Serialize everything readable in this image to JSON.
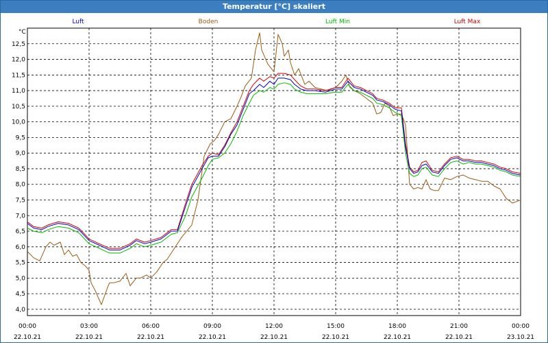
{
  "window": {
    "title": "Temperatur [°C] skaliert"
  },
  "chart_data": {
    "type": "line",
    "ylabel": "°C",
    "ylim": [
      3.8,
      13.0
    ],
    "y_ticks": [
      "4,0",
      "4,5",
      "5,0",
      "5,5",
      "6,0",
      "6,5",
      "7,0",
      "7,5",
      "8,0",
      "8,5",
      "9,0",
      "9,5",
      "10,0",
      "10,5",
      "11,0",
      "11,5",
      "12,0",
      "12,5"
    ],
    "y_tick_values": [
      4.0,
      4.5,
      5.0,
      5.5,
      6.0,
      6.5,
      7.0,
      7.5,
      8.0,
      8.5,
      9.0,
      9.5,
      10.0,
      10.5,
      11.0,
      11.5,
      12.0,
      12.5
    ],
    "x_range_hours": [
      0,
      24
    ],
    "x_ticks": [
      {
        "hour": 0,
        "time": "00:00",
        "date": "22.10.21"
      },
      {
        "hour": 3,
        "time": "03:00",
        "date": "22.10.21"
      },
      {
        "hour": 6,
        "time": "06:00",
        "date": "22.10.21"
      },
      {
        "hour": 9,
        "time": "09:00",
        "date": "22.10.21"
      },
      {
        "hour": 12,
        "time": "12:00",
        "date": "22.10.21"
      },
      {
        "hour": 15,
        "time": "15:00",
        "date": "22.10.21"
      },
      {
        "hour": 18,
        "time": "18:00",
        "date": "22.10.21"
      },
      {
        "hour": 21,
        "time": "21:00",
        "date": "22.10.21"
      },
      {
        "hour": 24,
        "time": "00:00",
        "date": "23.10.21"
      }
    ],
    "grid": true,
    "legend_position": "top",
    "series": [
      {
        "name": "Luft",
        "color": "#0000cc",
        "x": [
          0,
          0.3,
          0.7,
          1.0,
          1.5,
          2.0,
          2.5,
          3.0,
          3.5,
          4.0,
          4.5,
          5.0,
          5.3,
          5.7,
          6.0,
          6.5,
          7.0,
          7.3,
          7.7,
          8.0,
          8.5,
          8.8,
          9.0,
          9.3,
          9.6,
          9.9,
          10.2,
          10.5,
          10.8,
          11.0,
          11.3,
          11.5,
          11.8,
          12.0,
          12.2,
          12.5,
          12.8,
          13.0,
          13.3,
          13.6,
          14.0,
          14.5,
          15.0,
          15.3,
          15.6,
          15.9,
          16.2,
          16.5,
          16.8,
          17.0,
          17.3,
          17.6,
          17.9,
          18.2,
          18.4,
          18.6,
          18.8,
          19.0,
          19.2,
          19.4,
          19.7,
          20.0,
          20.3,
          20.6,
          20.9,
          21.2,
          21.5,
          21.8,
          22.1,
          22.4,
          22.7,
          23.0,
          23.3,
          23.6,
          24.0
        ],
        "y": [
          6.75,
          6.6,
          6.55,
          6.65,
          6.75,
          6.7,
          6.55,
          6.2,
          6.05,
          5.9,
          5.9,
          6.05,
          6.2,
          6.1,
          6.15,
          6.25,
          6.5,
          6.5,
          7.3,
          7.9,
          8.5,
          8.85,
          8.9,
          8.9,
          9.2,
          9.6,
          9.9,
          10.4,
          10.9,
          11.0,
          11.2,
          11.1,
          11.3,
          11.2,
          11.4,
          11.4,
          11.35,
          11.2,
          11.05,
          11.0,
          11.0,
          10.95,
          11.05,
          11.05,
          11.3,
          11.1,
          11.05,
          10.95,
          10.85,
          10.7,
          10.65,
          10.55,
          10.4,
          10.35,
          9.2,
          8.5,
          8.35,
          8.4,
          8.6,
          8.65,
          8.4,
          8.35,
          8.6,
          8.8,
          8.85,
          8.75,
          8.75,
          8.7,
          8.7,
          8.65,
          8.6,
          8.5,
          8.45,
          8.35,
          8.3
        ]
      },
      {
        "name": "Boden",
        "color": "#9c5a10",
        "x": [
          0,
          0.3,
          0.6,
          0.9,
          1.1,
          1.3,
          1.6,
          1.8,
          2.0,
          2.2,
          2.4,
          2.6,
          2.8,
          3.0,
          3.1,
          3.3,
          3.6,
          3.9,
          4.0,
          4.2,
          4.5,
          4.8,
          5.0,
          5.3,
          5.5,
          5.8,
          6.0,
          6.3,
          6.6,
          6.8,
          7.0,
          7.5,
          8.0,
          8.3,
          8.6,
          8.9,
          9.1,
          9.3,
          9.6,
          9.9,
          10.2,
          10.4,
          10.6,
          10.9,
          11.1,
          11.3,
          11.4,
          11.5,
          11.7,
          12.0,
          12.2,
          12.4,
          12.5,
          12.7,
          12.8,
          13.0,
          13.2,
          13.5,
          13.7,
          14.0,
          14.3,
          14.6,
          15.0,
          15.3,
          15.5,
          15.7,
          15.9,
          16.2,
          16.5,
          16.8,
          17.0,
          17.2,
          17.4,
          17.6,
          17.8,
          18.0,
          18.2,
          18.4,
          18.6,
          18.8,
          19.0,
          19.2,
          19.4,
          19.6,
          19.8,
          20.0,
          20.3,
          20.6,
          20.9,
          21.2,
          21.5,
          21.8,
          22.1,
          22.4,
          22.7,
          23.0,
          23.3,
          23.6,
          23.8,
          24.0
        ],
        "y": [
          5.85,
          5.65,
          5.55,
          6.0,
          6.15,
          6.05,
          6.15,
          5.75,
          5.9,
          5.7,
          5.75,
          5.5,
          5.4,
          5.25,
          4.85,
          4.6,
          4.15,
          4.7,
          4.85,
          4.85,
          4.9,
          5.15,
          4.75,
          5.0,
          5.0,
          5.1,
          5.0,
          5.2,
          5.5,
          5.6,
          5.8,
          6.3,
          6.7,
          7.5,
          8.9,
          9.3,
          9.4,
          9.6,
          10.0,
          10.1,
          10.5,
          10.8,
          11.15,
          11.4,
          12.3,
          12.85,
          12.3,
          12.15,
          11.85,
          11.6,
          12.8,
          12.5,
          12.1,
          12.3,
          11.9,
          11.5,
          11.7,
          11.2,
          11.3,
          11.1,
          11.05,
          11.0,
          11.1,
          11.3,
          11.5,
          11.1,
          11.0,
          10.9,
          10.75,
          10.6,
          10.25,
          10.3,
          10.6,
          10.5,
          10.2,
          10.25,
          10.25,
          9.9,
          8.0,
          7.85,
          7.9,
          7.85,
          8.15,
          7.85,
          7.8,
          7.8,
          8.2,
          8.15,
          8.25,
          8.3,
          8.2,
          8.15,
          8.1,
          8.1,
          7.95,
          7.85,
          7.55,
          7.4,
          7.45,
          7.5
        ]
      },
      {
        "name": "Luft Min",
        "color": "#00bb00",
        "x": [
          0,
          0.3,
          0.7,
          1.0,
          1.5,
          2.0,
          2.5,
          3.0,
          3.5,
          4.0,
          4.5,
          5.0,
          5.3,
          5.7,
          6.0,
          6.5,
          7.0,
          7.3,
          7.7,
          8.0,
          8.5,
          8.8,
          9.0,
          9.3,
          9.6,
          9.9,
          10.2,
          10.5,
          10.8,
          11.0,
          11.3,
          11.5,
          11.8,
          12.0,
          12.2,
          12.5,
          12.8,
          13.0,
          13.3,
          13.6,
          14.0,
          14.5,
          15.0,
          15.3,
          15.6,
          15.9,
          16.2,
          16.5,
          16.8,
          17.0,
          17.3,
          17.6,
          17.9,
          18.2,
          18.4,
          18.6,
          18.8,
          19.0,
          19.2,
          19.4,
          19.7,
          20.0,
          20.3,
          20.6,
          20.9,
          21.2,
          21.5,
          21.8,
          22.1,
          22.4,
          22.7,
          23.0,
          23.3,
          23.6,
          24.0
        ],
        "y": [
          6.6,
          6.5,
          6.45,
          6.55,
          6.65,
          6.6,
          6.45,
          6.1,
          5.95,
          5.8,
          5.8,
          5.95,
          6.1,
          6.0,
          6.05,
          6.15,
          6.4,
          6.45,
          7.0,
          7.6,
          8.2,
          8.6,
          8.8,
          8.85,
          9.0,
          9.3,
          9.7,
          10.2,
          10.6,
          10.85,
          11.0,
          10.95,
          11.1,
          11.05,
          11.2,
          11.25,
          11.2,
          11.05,
          10.95,
          10.9,
          10.9,
          10.9,
          10.95,
          10.95,
          11.2,
          11.0,
          10.95,
          10.85,
          10.75,
          10.6,
          10.55,
          10.45,
          10.3,
          10.2,
          9.0,
          8.35,
          8.25,
          8.3,
          8.5,
          8.55,
          8.3,
          8.25,
          8.5,
          8.7,
          8.75,
          8.65,
          8.7,
          8.65,
          8.65,
          8.6,
          8.55,
          8.45,
          8.4,
          8.3,
          8.25
        ]
      },
      {
        "name": "Luft Max",
        "color": "#cc0000",
        "x": [
          0,
          0.3,
          0.7,
          1.0,
          1.5,
          2.0,
          2.5,
          3.0,
          3.5,
          4.0,
          4.5,
          5.0,
          5.3,
          5.7,
          6.0,
          6.5,
          7.0,
          7.3,
          7.7,
          8.0,
          8.5,
          8.8,
          9.0,
          9.3,
          9.6,
          9.9,
          10.2,
          10.5,
          10.8,
          11.0,
          11.3,
          11.5,
          11.8,
          12.0,
          12.2,
          12.5,
          12.8,
          13.0,
          13.3,
          13.6,
          14.0,
          14.5,
          15.0,
          15.3,
          15.6,
          15.9,
          16.2,
          16.5,
          16.8,
          17.0,
          17.3,
          17.6,
          17.9,
          18.2,
          18.4,
          18.6,
          18.8,
          19.0,
          19.2,
          19.4,
          19.7,
          20.0,
          20.3,
          20.6,
          20.9,
          21.2,
          21.5,
          21.8,
          22.1,
          22.4,
          22.7,
          23.0,
          23.3,
          23.6,
          24.0
        ],
        "y": [
          6.8,
          6.65,
          6.6,
          6.7,
          6.8,
          6.75,
          6.6,
          6.25,
          6.1,
          5.95,
          5.95,
          6.1,
          6.25,
          6.15,
          6.2,
          6.3,
          6.55,
          6.55,
          7.4,
          8.0,
          8.6,
          8.9,
          9.0,
          8.95,
          9.25,
          9.65,
          10.0,
          10.5,
          11.0,
          11.2,
          11.4,
          11.3,
          11.45,
          11.4,
          11.55,
          11.55,
          11.5,
          11.35,
          11.15,
          11.05,
          11.05,
          11.0,
          11.1,
          11.1,
          11.4,
          11.15,
          11.1,
          11.0,
          10.9,
          10.75,
          10.7,
          10.6,
          10.45,
          10.45,
          9.3,
          8.55,
          8.4,
          8.45,
          8.7,
          8.75,
          8.45,
          8.4,
          8.65,
          8.85,
          8.9,
          8.8,
          8.8,
          8.75,
          8.75,
          8.7,
          8.65,
          8.55,
          8.5,
          8.4,
          8.35
        ]
      }
    ]
  }
}
